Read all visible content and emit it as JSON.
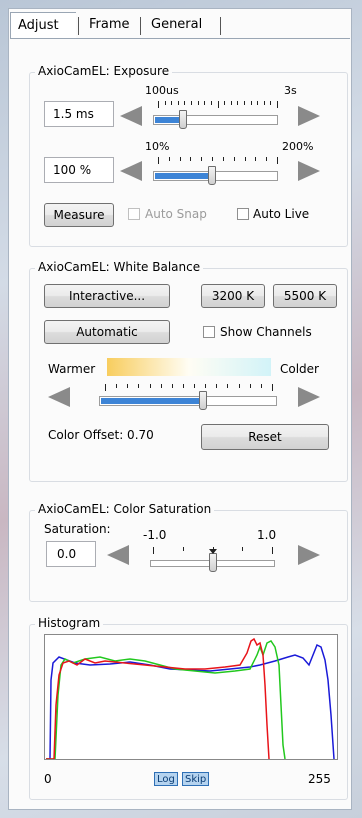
{
  "tabs": [
    {
      "label": "Adjust"
    },
    {
      "label": "Frame"
    },
    {
      "label": "General"
    }
  ],
  "exposure": {
    "title": "AxioCamEL: Exposure",
    "time": {
      "value": "1.5 ms",
      "min_label": "100us",
      "max_label": "3s",
      "level": 0.22
    },
    "intensity": {
      "value": "100 %",
      "min_label": "10%",
      "max_label": "200%",
      "level": 0.47
    },
    "measure_label": "Measure",
    "auto_snap_label": "Auto Snap",
    "auto_live_label": "Auto Live",
    "auto_snap_checked": false,
    "auto_live_checked": false
  },
  "white_balance": {
    "title": "AxioCamEL: White Balance",
    "interactive_label": "Interactive...",
    "k3200_label": "3200 K",
    "k5500_label": "5500 K",
    "automatic_label": "Automatic",
    "show_channels_label": "Show Channels",
    "show_channels_checked": false,
    "warmer_label": "Warmer",
    "colder_label": "Colder",
    "level": 0.59,
    "color_offset_text": "Color Offset: 0.70",
    "reset_label": "Reset",
    "gradient_colors": [
      "#f8cd5e",
      "#fffdf4",
      "#d2f3f8"
    ]
  },
  "saturation": {
    "title": "AxioCamEL: Color Saturation",
    "label": "Saturation:",
    "value": "0.0",
    "min_label": "-1.0",
    "max_label": "1.0",
    "level": 0.5
  },
  "histogram": {
    "title": "Histogram",
    "min_label": "0",
    "max_label": "255",
    "log_label": "Log",
    "skip_label": "Skip",
    "colors": {
      "red": "#e8141a",
      "green": "#22c81e",
      "blue": "#1a1ad8"
    },
    "accent": "#3d84d6"
  }
}
